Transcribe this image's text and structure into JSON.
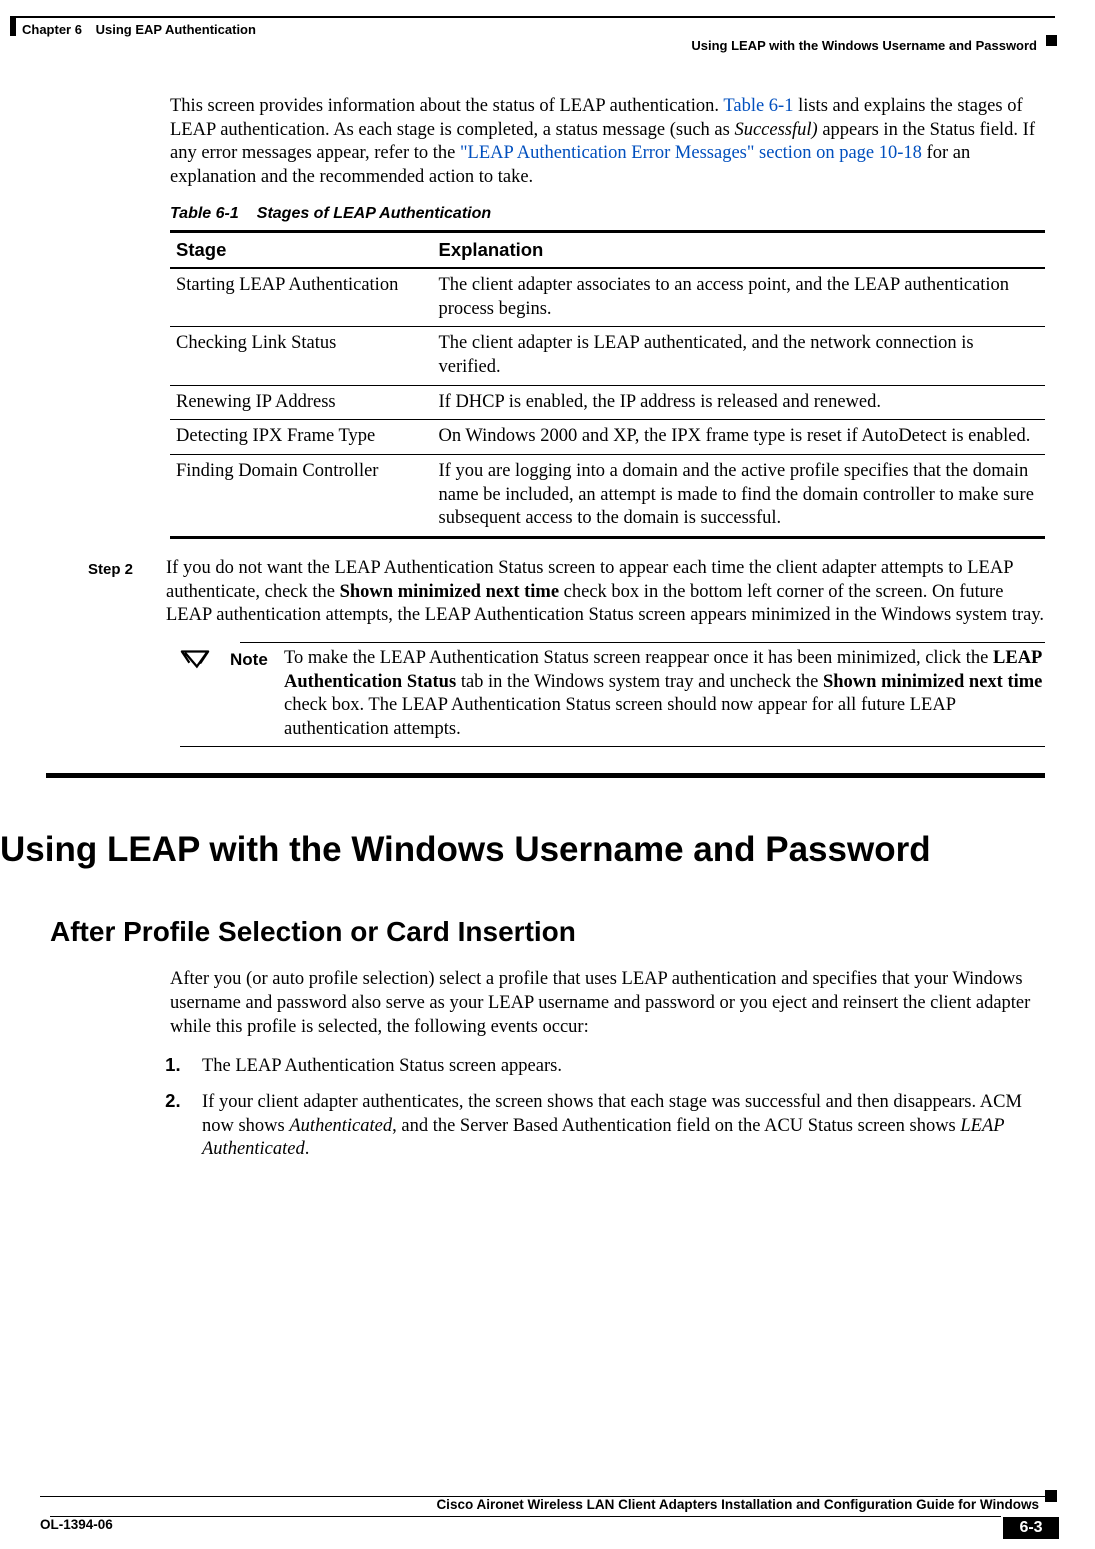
{
  "header": {
    "chapter": "Chapter 6",
    "chapterTitle": "Using EAP Authentication",
    "section": "Using LEAP with the Windows Username and Password"
  },
  "intro": {
    "pre": "This screen provides information about the status of LEAP authentication. ",
    "link1": "Table 6-1",
    "mid1": " lists and explains the stages of LEAP authentication. As each stage is completed, a status message (such as ",
    "ital": "Successful)",
    "mid2": " appears in the Status field. If any error messages appear, refer to the ",
    "link2": "\"LEAP Authentication Error Messages\" section on page 10-18",
    "post": " for an explanation and the recommended action to take."
  },
  "tableCaption": {
    "num": "Table 6-1",
    "title": "Stages of LEAP Authentication"
  },
  "tableHead": {
    "c1": "Stage",
    "c2": "Explanation"
  },
  "rows": [
    {
      "stage": "Starting LEAP Authentication",
      "exp": "The client adapter associates to an access point, and the LEAP authentication process begins."
    },
    {
      "stage": "Checking Link Status",
      "exp": "The client adapter is LEAP authenticated, and the network connection is verified."
    },
    {
      "stage": "Renewing IP Address",
      "exp": "If DHCP is enabled, the IP address is released and renewed."
    },
    {
      "stage": "Detecting IPX Frame Type",
      "exp": "On Windows 2000 and XP, the IPX frame type is reset if AutoDetect is enabled."
    },
    {
      "stage": "Finding Domain Controller",
      "exp": "If you are logging into a domain and the active profile specifies that the domain name be included, an attempt is made to find the domain controller to make sure subsequent access to the domain is successful."
    }
  ],
  "step2": {
    "label": "Step 2",
    "p1a": "If you do not want the LEAP Authentication Status screen to appear each time the client adapter attempts to LEAP authenticate, check the ",
    "p1b": "Shown minimized next time",
    "p1c": " check box in the bottom left corner of the screen. On future LEAP authentication attempts, the LEAP Authentication Status screen appears minimized in the Windows system tray."
  },
  "note": {
    "label": "Note",
    "a": "To make the LEAP Authentication Status screen reappear once it has been minimized, click the ",
    "b": "LEAP Authentication Status",
    "c": " tab in the Windows system tray and uncheck the ",
    "d": "Shown minimized next time",
    "e": " check box. The LEAP Authentication Status screen should now appear for all future LEAP authentication attempts."
  },
  "h1": "Using LEAP with the Windows Username and Password",
  "h2": "After Profile Selection or Card Insertion",
  "p2": "After you (or auto profile selection) select a profile that uses LEAP authentication and specifies that your Windows username and password also serve as your LEAP username and password or you eject and reinsert the client adapter while this profile is selected, the following events occur:",
  "ol": {
    "i1": "The LEAP Authentication Status screen appears.",
    "i2a": "If your client adapter authenticates, the screen shows that each stage was successful and then disappears. ACM now shows ",
    "i2b": "Authenticated",
    "i2c": ", and the Server Based Authentication field on the ACU Status screen shows ",
    "i2d": "LEAP Authenticated",
    "i2e": "."
  },
  "footer": {
    "title": "Cisco Aironet Wireless LAN Client Adapters Installation and Configuration Guide for Windows",
    "docnum": "OL-1394-06",
    "page": "6-3"
  }
}
